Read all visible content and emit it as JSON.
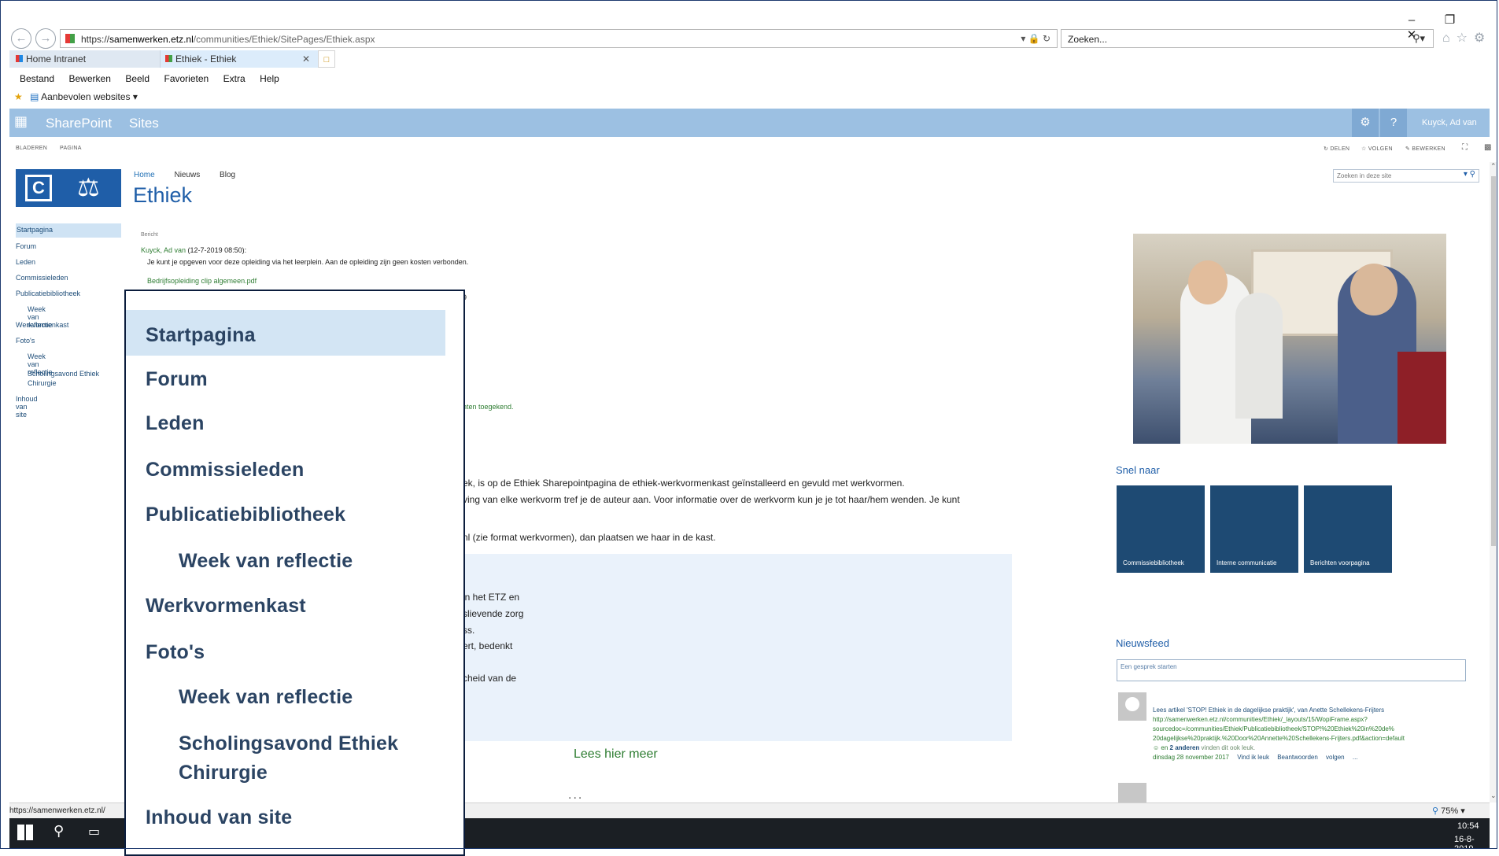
{
  "browser": {
    "url_prefix": "https://",
    "url_host": "samenwerken.etz.nl",
    "url_path": "/communities/Ethiek/SitePages/Ethiek.aspx",
    "search_placeholder": "Zoeken...",
    "tabs": [
      {
        "label": "Home Intranet",
        "active": false
      },
      {
        "label": "Ethiek - Ethiek",
        "active": true
      }
    ],
    "menu": [
      "Bestand",
      "Bewerken",
      "Beeld",
      "Favorieten",
      "Extra",
      "Help"
    ],
    "favorites_label": "Aanbevolen websites",
    "status_url": "https://samenwerken.etz.nl/",
    "zoom": "75%"
  },
  "suitebar": {
    "brand": "SharePoint",
    "sites": "Sites",
    "user": "Kuyck, Ad van"
  },
  "ribbon": {
    "left": [
      "BLADEREN",
      "PAGINA"
    ],
    "right": [
      "DELEN",
      "VOLGEN",
      "BEWERKEN"
    ]
  },
  "site": {
    "topnav": [
      "Home",
      "Nieuws",
      "Blog"
    ],
    "title": "Ethiek",
    "search_placeholder": "Zoeken in deze site"
  },
  "leftnav": [
    {
      "label": "Startpagina",
      "level": 0,
      "selected": true
    },
    {
      "label": "Forum",
      "level": 0
    },
    {
      "label": "Leden",
      "level": 0
    },
    {
      "label": "Commissieleden",
      "level": 0
    },
    {
      "label": "Publicatiebibliotheek",
      "level": 0
    },
    {
      "label": "Week van reflectie",
      "level": 1
    },
    {
      "label": "Werkvormenkast",
      "level": 0
    },
    {
      "label": "Foto's",
      "level": 0
    },
    {
      "label": "Week van reflectie",
      "level": 1
    },
    {
      "label": "Scholingsavond Ethiek Chirurgie",
      "level": 1
    },
    {
      "label": "Inhoud van site",
      "level": 0
    }
  ],
  "post": {
    "label": "Bericht",
    "author_line": "Kuyck, Ad van",
    "author_time": " (12-7-2019 08:50):",
    "text": "Je kunt je opgeven voor deze opleiding via het leerplein. Aan de opleiding zijn geen kosten verbonden.",
    "attachment": "Bedrijfsopleiding clip algemeen.pdf",
    "fragment_a": "9",
    "fragment_b": "nten toegekend."
  },
  "content_fragments": {
    "p1": "ek, is op de Ethiek Sharepointpagina de ethiek-werkvormenkast geïnstalleerd en gevuld met werkvormen.",
    "p2": "ving van elke werkvorm tref je de auteur aan. Voor informatie over de werkvorm kun je je tot haar/hem wenden. Je kunt",
    "p3": "nl (zie format werkvormen), dan plaatsen we haar in de kast.",
    "box": [
      "in het ETZ en",
      "slievende zorg",
      "ss.",
      "ert, bedenkt",
      "",
      "cheid van de"
    ],
    "more": "Lees hier meer",
    "dots": "..."
  },
  "quicklinks": {
    "heading": "Snel naar",
    "tiles": [
      "Commissiebibliotheek",
      "Interne communicatie",
      "Berichten voorpagina"
    ]
  },
  "newsfeed": {
    "heading": "Nieuwsfeed",
    "input_placeholder": "Een gesprek starten",
    "item": {
      "title": "Lees artikel 'STOP! Ethiek in de dagelijkse praktijk', van Anette Schellekens-Frijters",
      "link_1": "http://samenwerken.etz.nl/communities/Ethiek/_layouts/15/WopiFrame.aspx?",
      "link_2": "sourcedoc=/communities/Ethiek/Publicatiebibliotheek/STOP!%20Ethiek%20in%20de%",
      "link_3": "20dagelijkse%20praktijk.%20Door%20Annette%20Schellekens-Frijters.pdf&action=default",
      "likes_prefix": "en ",
      "likes_bold": "2 anderen",
      "likes_suffix": " vinden dit ook leuk.",
      "date": "dinsdag 28 november 2017",
      "actions": [
        "Vind ik leuk",
        "Beantwoorden",
        "volgen",
        "..."
      ]
    }
  },
  "magnifier": [
    {
      "label": "Startpagina",
      "level": 0,
      "selected": true
    },
    {
      "label": "Forum",
      "level": 0
    },
    {
      "label": "Leden",
      "level": 0
    },
    {
      "label": "Commissieleden",
      "level": 0
    },
    {
      "label": "Publicatiebibliotheek",
      "level": 0
    },
    {
      "label": "Week van reflectie",
      "level": 1
    },
    {
      "label": "Werkvormenkast",
      "level": 0
    },
    {
      "label": "Foto's",
      "level": 0
    },
    {
      "label": "Week van reflectie",
      "level": 1
    },
    {
      "label": "Scholingsavond Ethiek",
      "level": 1
    },
    {
      "label": "Chirurgie",
      "level": 1
    },
    {
      "label": "Inhoud van site",
      "level": 0
    }
  ],
  "taskbar": {
    "time": "10:54",
    "date": "16-8-2019"
  },
  "colors": {
    "suitebar": "#9cc0e2",
    "tile": "#1e4a73",
    "link_blue": "#1f4e79",
    "link_green": "#2e7d32"
  }
}
